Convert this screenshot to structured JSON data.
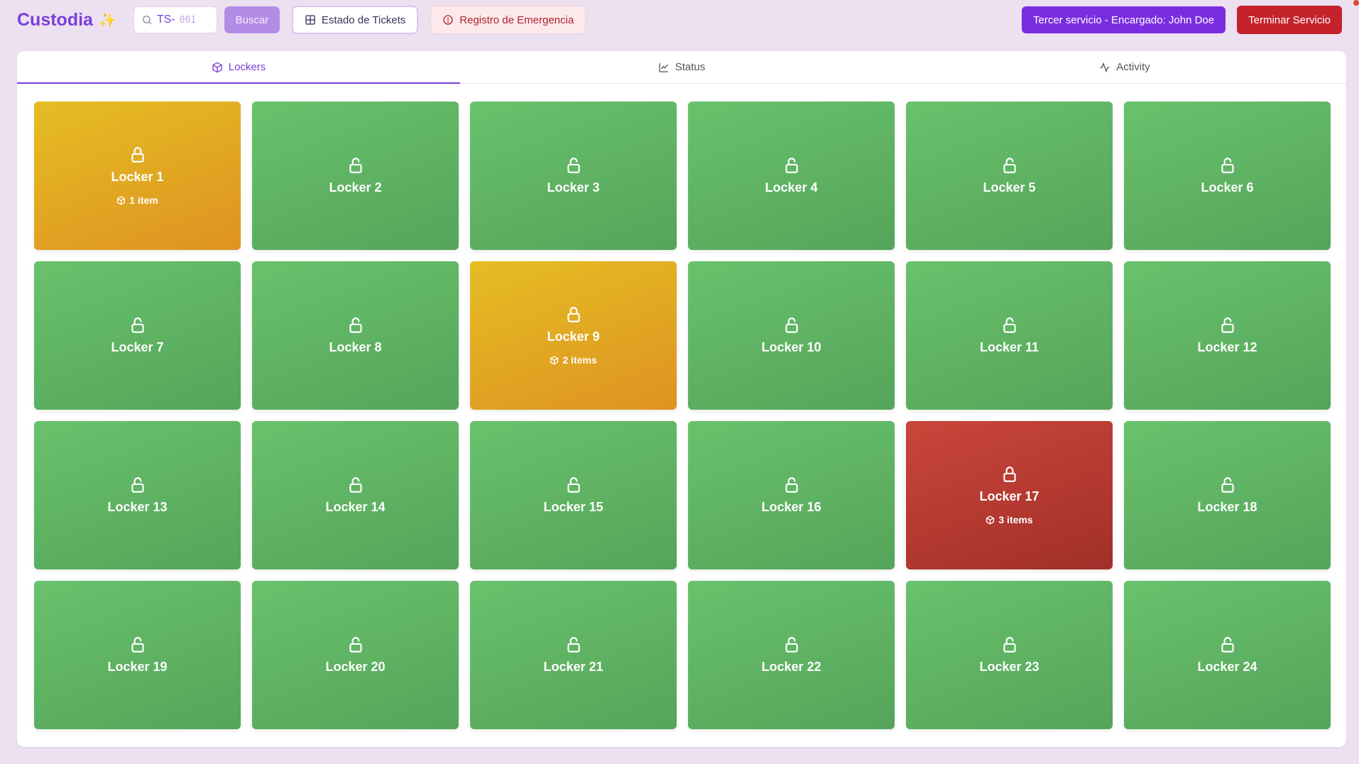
{
  "app": {
    "title": "Custodia",
    "title_emoji": "✨"
  },
  "search": {
    "prefix": "TS-",
    "placeholder": "001",
    "value": ""
  },
  "toolbar": {
    "search_button": "Buscar",
    "tickets_button": "Estado de Tickets",
    "emergency_button": "Registro de Emergencia",
    "service_label": "Tercer servicio - Encargado: John Doe",
    "end_service_button": "Terminar Servicio"
  },
  "tabs": [
    {
      "label": "Lockers",
      "icon": "box-icon",
      "active": true
    },
    {
      "label": "Status",
      "icon": "chart-icon",
      "active": false
    },
    {
      "label": "Activity",
      "icon": "activity-icon",
      "active": false
    }
  ],
  "colors": {
    "accent": "#7b3fd8",
    "locker_free": "#5fb563",
    "locker_occupied": "#e1a823",
    "locker_alert": "#b8392f",
    "danger": "#c4232b"
  },
  "lockers": [
    {
      "name": "Locker 1",
      "status": "occupied",
      "items": "1 item"
    },
    {
      "name": "Locker 2",
      "status": "free",
      "items": ""
    },
    {
      "name": "Locker 3",
      "status": "free",
      "items": ""
    },
    {
      "name": "Locker 4",
      "status": "free",
      "items": ""
    },
    {
      "name": "Locker 5",
      "status": "free",
      "items": ""
    },
    {
      "name": "Locker 6",
      "status": "free",
      "items": ""
    },
    {
      "name": "Locker 7",
      "status": "free",
      "items": ""
    },
    {
      "name": "Locker 8",
      "status": "free",
      "items": ""
    },
    {
      "name": "Locker 9",
      "status": "occupied",
      "items": "2 items"
    },
    {
      "name": "Locker 10",
      "status": "free",
      "items": ""
    },
    {
      "name": "Locker 11",
      "status": "free",
      "items": ""
    },
    {
      "name": "Locker 12",
      "status": "free",
      "items": ""
    },
    {
      "name": "Locker 13",
      "status": "free",
      "items": ""
    },
    {
      "name": "Locker 14",
      "status": "free",
      "items": ""
    },
    {
      "name": "Locker 15",
      "status": "free",
      "items": ""
    },
    {
      "name": "Locker 16",
      "status": "free",
      "items": ""
    },
    {
      "name": "Locker 17",
      "status": "alert",
      "items": "3 items"
    },
    {
      "name": "Locker 18",
      "status": "free",
      "items": ""
    },
    {
      "name": "Locker 19",
      "status": "free",
      "items": ""
    },
    {
      "name": "Locker 20",
      "status": "free",
      "items": ""
    },
    {
      "name": "Locker 21",
      "status": "free",
      "items": ""
    },
    {
      "name": "Locker 22",
      "status": "free",
      "items": ""
    },
    {
      "name": "Locker 23",
      "status": "free",
      "items": ""
    },
    {
      "name": "Locker 24",
      "status": "free",
      "items": ""
    }
  ]
}
